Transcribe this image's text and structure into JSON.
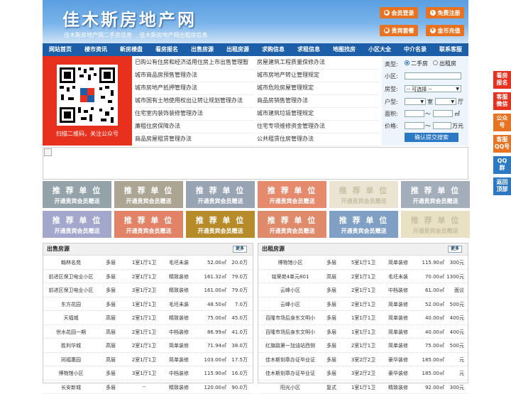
{
  "header": {
    "logo": "佳木斯房地产网",
    "slogan": "佳木斯房地产网二手房信息 佳木斯房地产网出租房信息",
    "buttons": [
      {
        "label": "会员登录",
        "icon": "person-icon"
      },
      {
        "label": "免费注册",
        "icon": "plus-icon"
      },
      {
        "label": "贵宾套餐",
        "icon": "gift-icon"
      },
      {
        "label": "金币充值",
        "icon": "coin-icon"
      }
    ]
  },
  "nav": [
    "网站首页",
    "楼市资讯",
    "新房楼盘",
    "看房报名",
    "出售房源",
    "出租房源",
    "求购信息",
    "求租信息",
    "地图找房",
    "小区大全",
    "中介名录",
    "联系客服"
  ],
  "qr": {
    "text": "扫描二维码，关注公众号"
  },
  "news": {
    "left": [
      "已购公有住房和经济适用住房上市出售管理暂",
      "城市商品房预售管理办法",
      "城市房地产抵押管理办法",
      "城市国有土地使用权出让转让规划管理办法",
      "住宅室内装饰装修管理办法",
      "廉租住房保障办法",
      "商品房屋租赁管理办法"
    ],
    "right": [
      "房屋建筑工程质量保修办法",
      "城市房地产转让管理规定",
      "城市危险房屋管理规定",
      "商品房销售管理办法",
      "城市建筑垃圾管理规定",
      "住宅专项维修资金管理办法",
      "公共租赁住房管理办法"
    ]
  },
  "search": {
    "type_label": "类型:",
    "opt1": "二手房",
    "opt2": "出租房",
    "xiaoqu_label": "小区:",
    "fangxing_label": "房型:",
    "fangxing_value": "-- 可选择 --",
    "huxing_label": "户型:",
    "huxing_unit1": "室",
    "huxing_unit2": "厅",
    "area_label": "面积:",
    "area_sep": "～",
    "area_unit": "㎡",
    "price_label": "价格:",
    "price_sep": "～",
    "price_unit": "万元",
    "submit": "确认提交搜索"
  },
  "tiles": {
    "title": "推 荐 单 位",
    "sub": "开通贵宾会员赠送",
    "colors": [
      "#93a3a9",
      "#ada594",
      "#98a3b4",
      "#e58a6c",
      "#ece4d2",
      "#a4aebb",
      "#a3a7cc",
      "#e28266",
      "#b78b2a",
      "#e08a6c",
      "#7f9fc4",
      "#e9e1c4"
    ]
  },
  "sale": {
    "title": "出售房源",
    "more": "更多",
    "rows": [
      [
        "翰林名苑",
        "多层",
        "1室1厅1卫",
        "毛坯未装",
        "52.00㎡",
        "20.0万"
      ],
      [
        "前进区保卫电业小区",
        "多层",
        "2室1厅1卫",
        "精致装修",
        "161.32㎡",
        "79.0万"
      ],
      [
        "前进区保卫电业小区",
        "多层",
        "3室1厅2卫",
        "精致装修",
        "161.00㎡",
        "79.0万"
      ],
      [
        "东方花园",
        "多层",
        "1室1厅1卫",
        "毛坯未装",
        "48.50㎡",
        "7.0万"
      ],
      [
        "天福城",
        "高层",
        "2室1厅1卫",
        "精致装修",
        "75.00㎡",
        "45.0万"
      ],
      [
        "世水花园一期",
        "高层",
        "2室1厅1卫",
        "中档装修",
        "86.99㎡",
        "41.0万"
      ],
      [
        "胜利华城",
        "高层",
        "2室1厅1卫",
        "简单装修",
        "71.94㎡",
        "38.0万"
      ],
      [
        "同福惠园",
        "高层",
        "2室1厅1卫",
        "简单装修",
        "103.00㎡",
        "17.5万"
      ],
      [
        "博物馆小区",
        "多层",
        "3室1厅1卫",
        "中档装修",
        "115.90㎡",
        "16.0万"
      ],
      [
        "长安新城",
        "多层",
        "--",
        "精致装修",
        "120.00㎡",
        "90.0万"
      ]
    ]
  },
  "rent": {
    "title": "出租房源",
    "more": "更多",
    "rows": [
      [
        "博物馆小区",
        "多层",
        "5室1厅1卫",
        "简单装修",
        "115.90㎡",
        "300元"
      ],
      [
        "铭荣苑4单元801",
        "高层",
        "2室1厅1卫",
        "毛坯未装",
        "70.00㎡",
        "1300元"
      ],
      [
        "云峰小区",
        "多层",
        "2室1厅1卫",
        "中档装修",
        "61.00㎡",
        "面议"
      ],
      [
        "云峰小区",
        "多层",
        "2室1厅1卫",
        "简单装修",
        "52.00㎡",
        "500元"
      ],
      [
        "百隆市场后身东文明小",
        "多层",
        "1室1厅1卫",
        "简单装修",
        "40.00㎡",
        "400元"
      ],
      [
        "百隆市场后身东文明小",
        "多层",
        "1室1厅1卫",
        "简单装修",
        "40.00㎡",
        "400元"
      ],
      [
        "红旗路第一加油站西侧",
        "多层",
        "2室1厅1卫",
        "简单装修",
        "75.00㎡",
        "500元"
      ],
      [
        "佳木斯刻章办证毕业证",
        "多层",
        "3室2厅2卫",
        "豪华装修",
        "185.00㎡",
        "元"
      ],
      [
        "佳木斯刻章办证毕业证",
        "多层",
        "3室2厅2卫",
        "豪华装修",
        "185.00㎡",
        "元"
      ],
      [
        "阳光小区",
        "复式",
        "1室1厅1卫",
        "精致装修",
        "92.00㎡",
        "300元"
      ]
    ]
  },
  "sidebar": [
    "看房报名",
    "客服微信",
    "公众号",
    "客服QQ号",
    "QQ群",
    "返回顶部"
  ],
  "sidebar_colors": [
    "#e8301f",
    "#e8301f",
    "#e8721f",
    "#e8721f",
    "#2b78c5",
    "#2b78c5"
  ]
}
